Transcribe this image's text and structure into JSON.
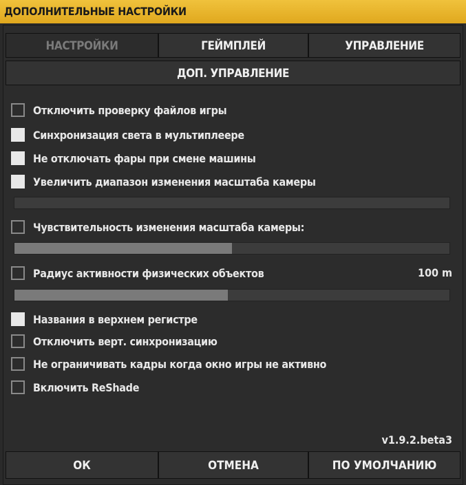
{
  "window": {
    "title": "ДОПОЛНИТЕЛЬНЫЕ НАСТРОЙКИ"
  },
  "tabs": [
    {
      "label": "НАСТРОЙКИ",
      "active": true
    },
    {
      "label": "ГЕЙМПЛЕЙ",
      "active": false
    },
    {
      "label": "УПРАВЛЕНИЕ",
      "active": false
    },
    {
      "label": "ДОП. УПРАВЛЕНИЕ",
      "active": false
    }
  ],
  "options": [
    {
      "label": "Отключить проверку файлов игры",
      "checked": false
    },
    {
      "label": "Синхронизация света в мультиплеере",
      "checked": true
    },
    {
      "label": "Не отключать фары при смене машины",
      "checked": true
    },
    {
      "label": "Увеличить диапазон изменения масштаба камеры",
      "checked": true
    },
    {
      "label": "Чувствительность изменения масштаба камеры:",
      "checked": false
    },
    {
      "label": "Радиус активности физических объектов",
      "checked": false,
      "value": "100 m"
    },
    {
      "label": "Названия в верхнем регистре",
      "checked": true
    },
    {
      "label": "Отключить верт. синхронизацию",
      "checked": false
    },
    {
      "label": "Не ограничивать кадры когда окно игры не активно",
      "checked": false
    },
    {
      "label": "Включить ReShade",
      "checked": false
    }
  ],
  "sliders": {
    "zoom_range": {
      "fraction": 0.0
    },
    "zoom_sensitivity": {
      "fraction": 0.5
    },
    "physics_radius": {
      "fraction": 0.49
    }
  },
  "version": "v1.9.2.beta3",
  "buttons": {
    "ok": "ОК",
    "cancel": "ОТМЕНА",
    "defaults": "ПО УМОЛЧАНИЮ"
  }
}
